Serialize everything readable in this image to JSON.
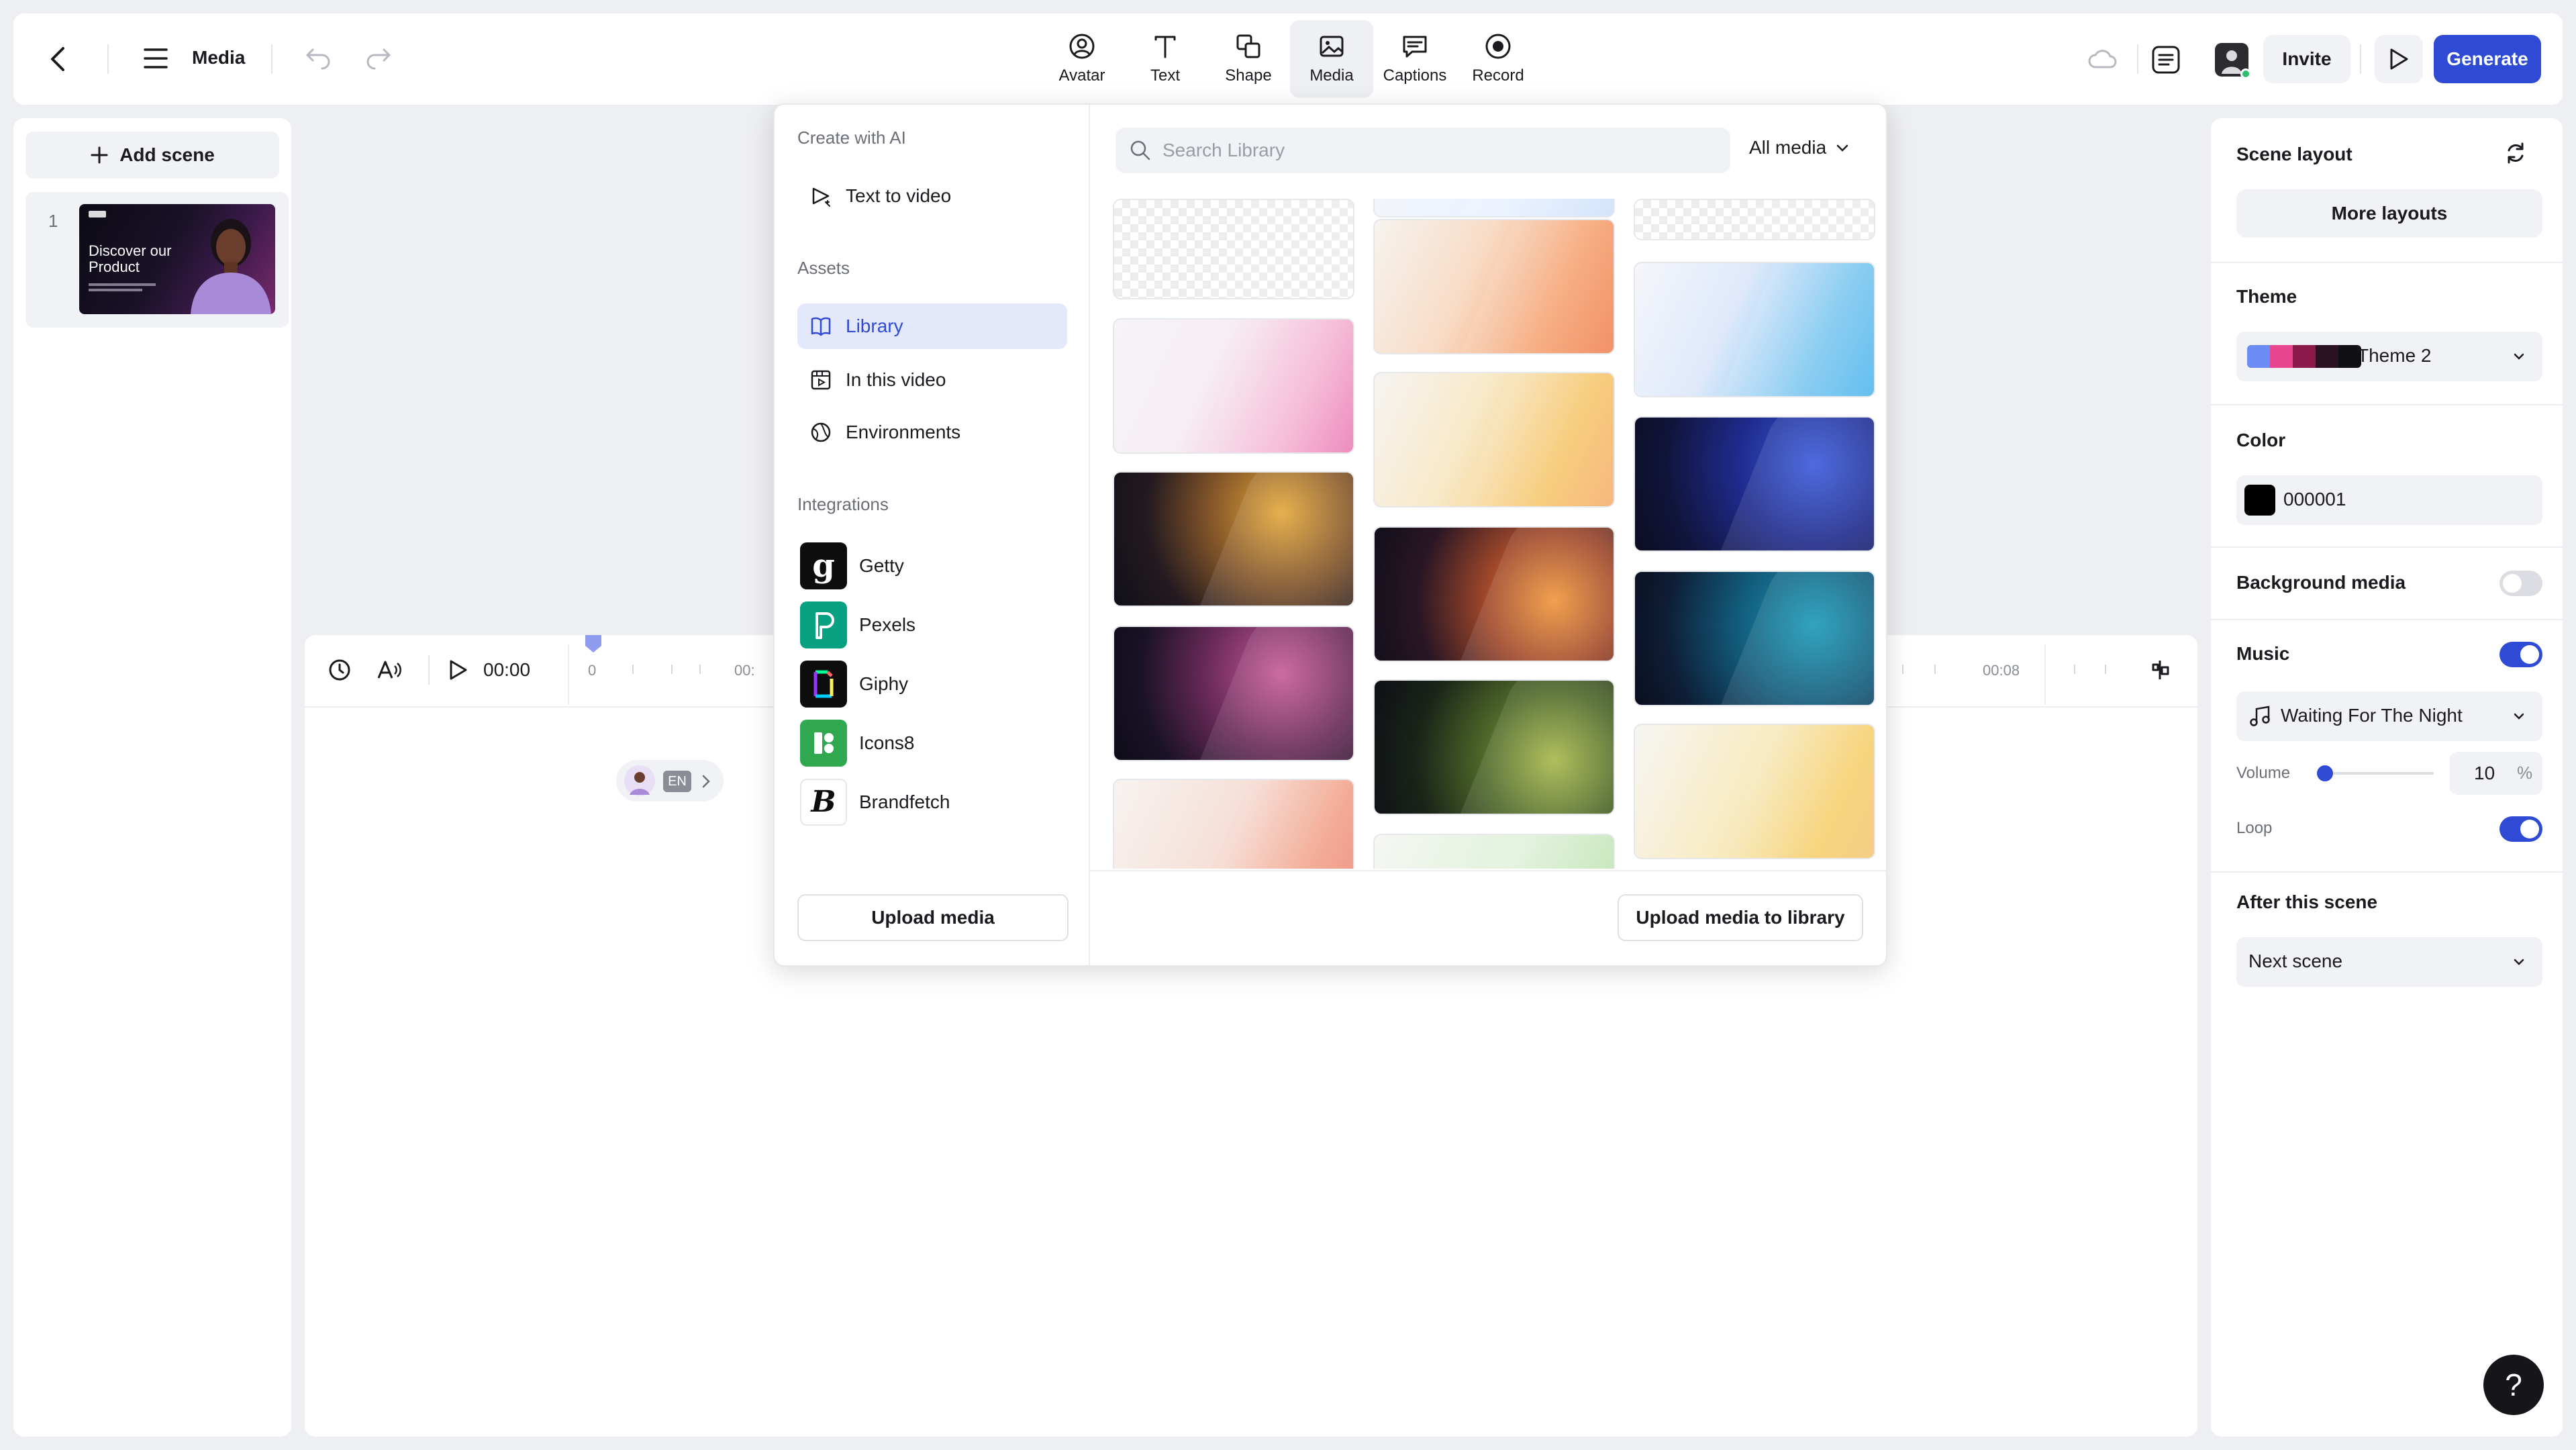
{
  "header": {
    "title": "Media",
    "tools": [
      {
        "label": "Avatar",
        "icon": "avatar-icon"
      },
      {
        "label": "Text",
        "icon": "text-icon"
      },
      {
        "label": "Shape",
        "icon": "shape-icon"
      },
      {
        "label": "Media",
        "icon": "media-icon",
        "active": true
      },
      {
        "label": "Captions",
        "icon": "captions-icon"
      },
      {
        "label": "Record",
        "icon": "record-icon"
      }
    ],
    "invite_label": "Invite",
    "generate_label": "Generate"
  },
  "scenes": {
    "add_label": "Add scene",
    "items": [
      {
        "number": "1",
        "thumb_title": "Discover our Product"
      }
    ]
  },
  "timeline": {
    "time": "00:00",
    "tick_start": "0",
    "tick_partial": "00:",
    "tick_end": "00:08",
    "lang_badge": "EN"
  },
  "media_menu": {
    "create_section": "Create with AI",
    "text_to_video": "Text to video",
    "assets_section": "Assets",
    "assets": [
      {
        "label": "Library",
        "icon": "book-icon",
        "active": true
      },
      {
        "label": "In this video",
        "icon": "film-icon"
      },
      {
        "label": "Environments",
        "icon": "globe-icon"
      }
    ],
    "integrations_section": "Integrations",
    "integrations": [
      {
        "label": "Getty",
        "icon": "getty-logo-icon"
      },
      {
        "label": "Pexels",
        "icon": "pexels-logo-icon"
      },
      {
        "label": "Giphy",
        "icon": "giphy-logo-icon"
      },
      {
        "label": "Icons8",
        "icon": "icons8-logo-icon"
      },
      {
        "label": "Brandfetch",
        "icon": "brandfetch-logo-icon"
      }
    ],
    "upload_label": "Upload media",
    "search_placeholder": "Search Library",
    "filter_label": "All media",
    "upload_library_label": "Upload media to library"
  },
  "right_panel": {
    "scene_layout_label": "Scene layout",
    "more_layouts_label": "More layouts",
    "theme_label": "Theme",
    "theme_value": "Theme 2",
    "theme_swatches": [
      "#6b8cf5",
      "#e8468f",
      "#8a1a4a",
      "#2a1222",
      "#101014"
    ],
    "color_label": "Color",
    "color_value": "000001",
    "background_media_label": "Background media",
    "background_media_on": false,
    "music_label": "Music",
    "music_on": true,
    "music_track": "Waiting For The Night",
    "volume_label": "Volume",
    "volume_value": "10",
    "volume_unit": "%",
    "loop_label": "Loop",
    "loop_on": true,
    "after_scene_label": "After this scene",
    "after_scene_value": "Next scene"
  }
}
